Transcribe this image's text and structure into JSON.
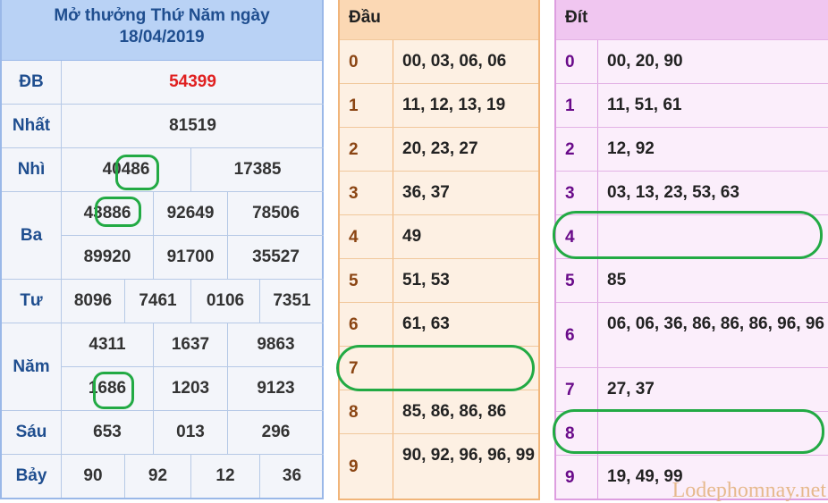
{
  "header": {
    "line1": "Mở thưởng Thứ Năm ngày",
    "line2": "18/04/2019"
  },
  "labels": {
    "db": "ĐB",
    "nhat": "Nhất",
    "nhi": "Nhì",
    "ba": "Ba",
    "tu": "Tư",
    "nam": "Năm",
    "sau": "Sáu",
    "bay": "Bảy"
  },
  "prizes": {
    "db": "54399",
    "nhat": "81519",
    "nhi": [
      "40486",
      "17385"
    ],
    "ba": [
      "43886",
      "92649",
      "78506",
      "89920",
      "91700",
      "35527"
    ],
    "tu": [
      "8096",
      "7461",
      "0106",
      "7351"
    ],
    "nam": [
      "4311",
      "1637",
      "9863",
      "1686",
      "1203",
      "9123"
    ],
    "sau": [
      "653",
      "013",
      "296"
    ],
    "bay": [
      "90",
      "92",
      "12",
      "36"
    ]
  },
  "dau": {
    "title": "Đầu",
    "rows": [
      {
        "k": "0",
        "v": "00, 03, 06, 06"
      },
      {
        "k": "1",
        "v": "11, 12, 13, 19"
      },
      {
        "k": "2",
        "v": "20, 23, 27"
      },
      {
        "k": "3",
        "v": "36, 37"
      },
      {
        "k": "4",
        "v": "49"
      },
      {
        "k": "5",
        "v": "51, 53"
      },
      {
        "k": "6",
        "v": "61, 63"
      },
      {
        "k": "7",
        "v": ""
      },
      {
        "k": "8",
        "v": "85, 86, 86, 86"
      },
      {
        "k": "9",
        "v": "90, 92, 96, 96, 99"
      }
    ]
  },
  "dit": {
    "title": "Đít",
    "rows": [
      {
        "k": "0",
        "v": "00, 20, 90"
      },
      {
        "k": "1",
        "v": "11, 51, 61"
      },
      {
        "k": "2",
        "v": "12, 92"
      },
      {
        "k": "3",
        "v": "03, 13, 23, 53, 63"
      },
      {
        "k": "4",
        "v": ""
      },
      {
        "k": "5",
        "v": "85"
      },
      {
        "k": "6",
        "v": "06, 06, 36, 86, 86, 86, 96, 96"
      },
      {
        "k": "7",
        "v": "27, 37"
      },
      {
        "k": "8",
        "v": ""
      },
      {
        "k": "9",
        "v": "19, 49, 99"
      }
    ]
  },
  "watermark": "Lodephomnay.net",
  "colors": {
    "highlight": "#22aa44",
    "special_prize": "#e02020"
  }
}
